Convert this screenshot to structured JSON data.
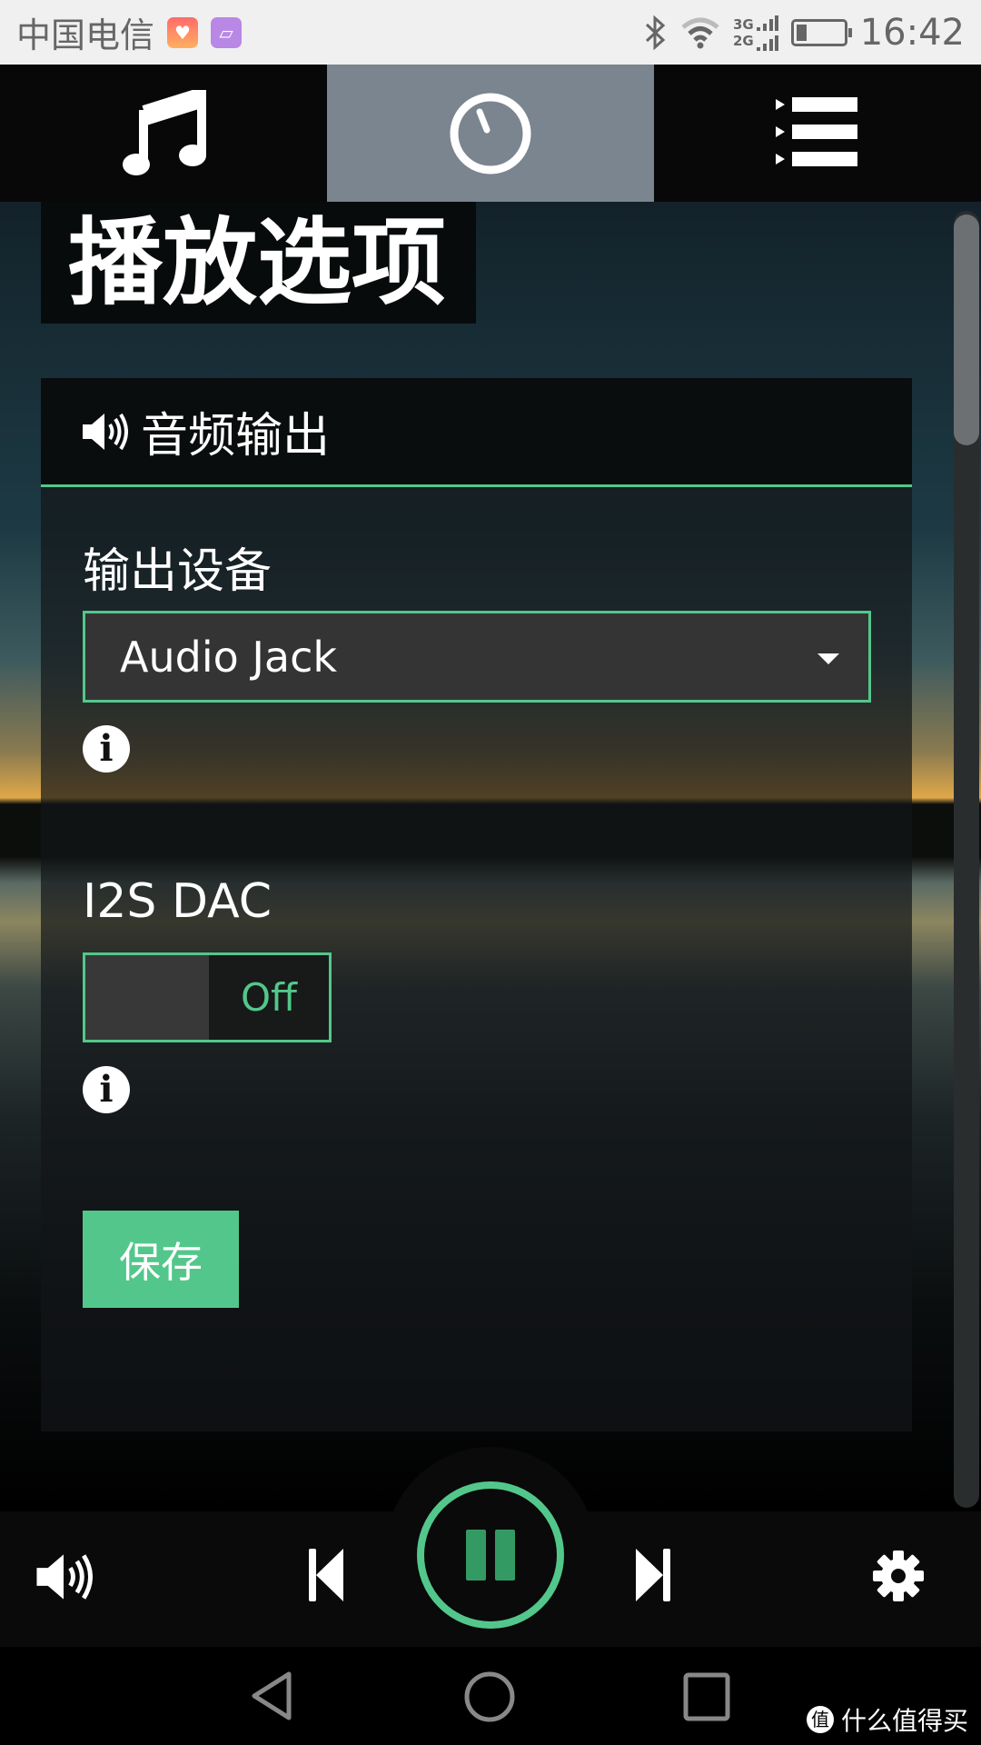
{
  "status_bar": {
    "carrier": "中国电信",
    "network_top": "3G",
    "network_bottom": "2G",
    "time": "16:42",
    "battery_level": 0.2,
    "icons": [
      "health-app-icon",
      "gallery-app-icon",
      "bluetooth-icon",
      "wifi-icon",
      "signal-icon",
      "battery-icon"
    ]
  },
  "tabs": [
    {
      "icon": "music-note-icon",
      "active": false
    },
    {
      "icon": "dial-icon",
      "active": true
    },
    {
      "icon": "playlist-icon",
      "active": false
    }
  ],
  "page": {
    "title": "播放选项"
  },
  "panel": {
    "header": "音频输出",
    "output_device_label": "输出设备",
    "output_device_value": "Audio Jack",
    "i2s_label": "I2S DAC",
    "i2s_toggle": "Off",
    "save_label": "保存"
  },
  "player": {
    "state": "playing",
    "icons": [
      "volume-icon",
      "previous-icon",
      "pause-icon",
      "next-icon",
      "gear-icon"
    ]
  },
  "watermark": {
    "logo": "值",
    "text": "什么值得买"
  },
  "colors": {
    "accent": "#53c78b",
    "pause": "#349a63",
    "active_tab": "#7b8590"
  }
}
